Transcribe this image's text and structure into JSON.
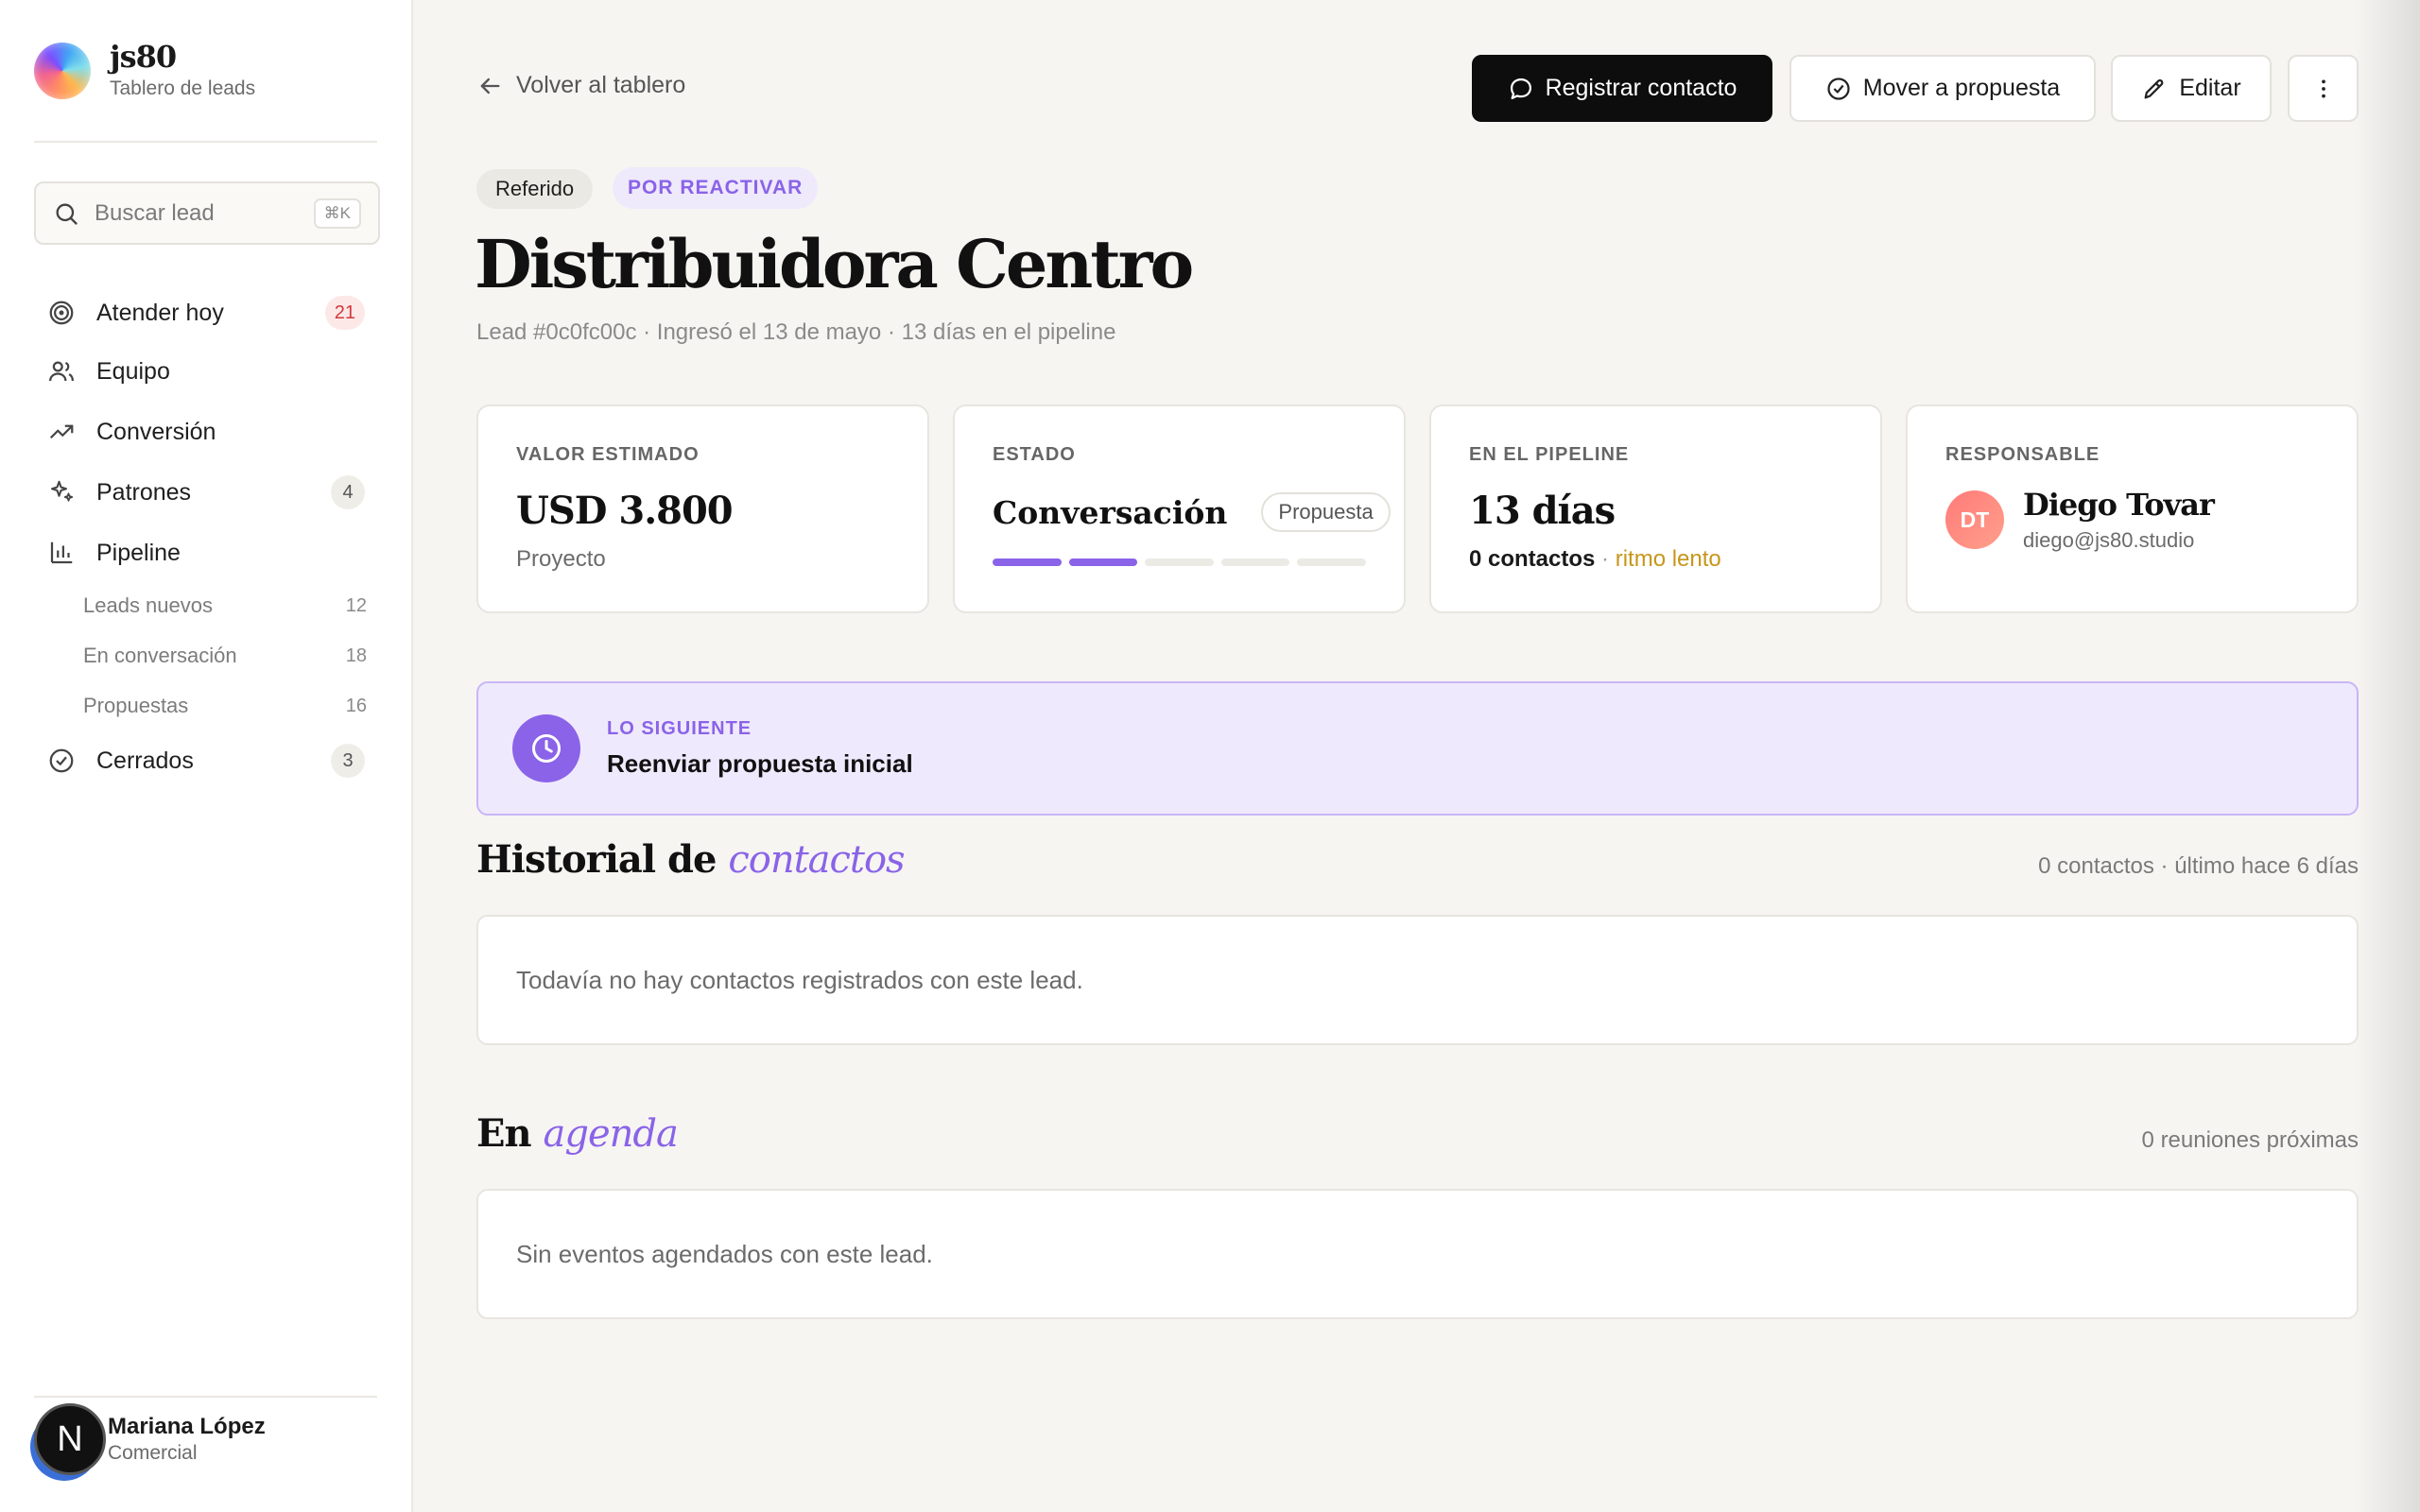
{
  "brand": {
    "name": "js80",
    "subtitle": "Tablero de leads"
  },
  "search": {
    "placeholder": "Buscar lead",
    "shortcut": "⌘K"
  },
  "nav": {
    "attend_today": {
      "label": "Atender hoy",
      "count": "21"
    },
    "team": {
      "label": "Equipo"
    },
    "conversion": {
      "label": "Conversión"
    },
    "patterns": {
      "label": "Patrones",
      "count": "4"
    },
    "pipeline": {
      "label": "Pipeline",
      "sub": [
        {
          "label": "Leads nuevos",
          "count": "12"
        },
        {
          "label": "En conversación",
          "count": "18"
        },
        {
          "label": "Propuestas",
          "count": "16"
        }
      ]
    },
    "closed": {
      "label": "Cerrados",
      "count": "3"
    }
  },
  "user": {
    "initial": "N",
    "name": "Mariana López",
    "role": "Comercial"
  },
  "header": {
    "back_label": "Volver al tablero",
    "register_label": "Registrar contacto",
    "move_label": "Mover a propuesta",
    "edit_label": "Editar"
  },
  "lead": {
    "source_tag": "Referido",
    "status_tag": "POR REACTIVAR",
    "title": "Distribuidora Centro",
    "meta": "Lead #0c0fc00c · Ingresó el 13 de mayo · 13 días en el pipeline"
  },
  "cards": {
    "value": {
      "label": "VALOR ESTIMADO",
      "amount": "USD 3.800",
      "sub": "Proyecto"
    },
    "state": {
      "label": "ESTADO",
      "name": "Conversación",
      "next_stage": "Propuesta",
      "progress_done": 2,
      "progress_total": 5
    },
    "pipeline": {
      "label": "EN EL PIPELINE",
      "days": "13 días",
      "contacts": "0 contactos",
      "separator": " · ",
      "pace": "ritmo lento"
    },
    "owner": {
      "label": "RESPONSABLE",
      "initials": "DT",
      "name": "Diego Tovar",
      "email": "diego@js80.studio"
    }
  },
  "next_step": {
    "label": "LO SIGUIENTE",
    "title": "Reenviar propuesta inicial"
  },
  "history": {
    "title_plain": "Historial de ",
    "title_accent": "contactos",
    "meta": "0 contactos · último hace 6 días",
    "empty": "Todavía no hay contactos registrados con este lead."
  },
  "agenda": {
    "title_plain": "En ",
    "title_accent": "agenda",
    "meta": "0 reuniones próximas",
    "empty": "Sin eventos agendados con este lead."
  },
  "colors": {
    "accent": "#8a63e8",
    "primary_button": "#0d0d0d",
    "badge_red": "#d23a3a",
    "pace_amber": "#c7961a"
  },
  "icons": {
    "back": "arrow-left-icon",
    "register": "chat-bubble-icon",
    "move": "check-circle-icon",
    "edit": "pencil-icon",
    "more": "more-vertical-icon",
    "next": "clock-icon"
  }
}
